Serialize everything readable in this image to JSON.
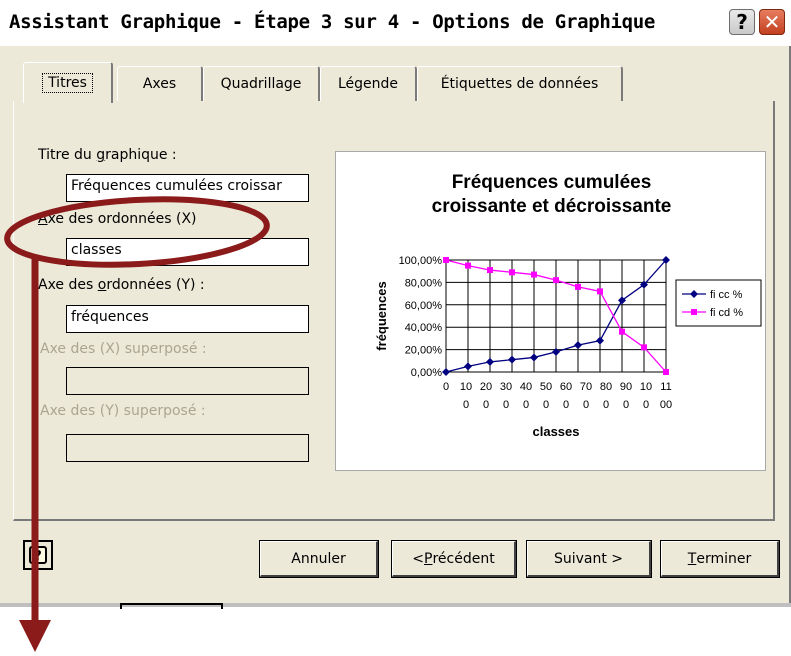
{
  "window": {
    "title": "Assistant Graphique - Étape 3 sur 4 - Options de Graphique",
    "help_glyph": "?",
    "close_glyph": "✕"
  },
  "tabs": [
    {
      "label": "Titres",
      "active": true
    },
    {
      "label": "Axes",
      "active": false
    },
    {
      "label": "Quadrillage",
      "active": false
    },
    {
      "label": "Légende",
      "active": false
    },
    {
      "label": "Étiquettes de données",
      "active": false
    }
  ],
  "form": {
    "chart_title_label_pre": "Titre du ",
    "chart_title_label_key": "g",
    "chart_title_label_post": "raphique :",
    "chart_title_value": "Fréquences cumulées croissar",
    "x_axis_label_key": "A",
    "x_axis_label_post": "xe des ordonnées (X)",
    "x_axis_value": "classes",
    "y_axis_label_pre": "Axe des ",
    "y_axis_label_key": "o",
    "y_axis_label_post": "rdonnées (Y) :",
    "y_axis_value": "fréquences",
    "x2_axis_label": "Axe des (X)  superposé :",
    "x2_axis_value": "",
    "y2_axis_label": "Axe des (Y) superposé :",
    "y2_axis_value": ""
  },
  "buttons": {
    "cancel": "Annuler",
    "prev_pre": "< ",
    "prev_key": "P",
    "prev_post": "récédent",
    "next": "Suivant >",
    "finish_key": "T",
    "finish_post": "erminer",
    "help_icon": "?"
  },
  "colors": {
    "dialog_bg": "#ece9d8",
    "annotation": "#8b1a1a",
    "series1": "#000080",
    "series2": "#ff00ff",
    "plot_bg": "#ffffff"
  },
  "chart_data": {
    "type": "line",
    "title_line1": "Fréquences cumulées",
    "title_line2": "croissante et décroissante",
    "xlabel": "classes",
    "ylabel": "fréquences",
    "x_tick_top": [
      "0",
      "10",
      "20",
      "30",
      "40",
      "50",
      "60",
      "70",
      "80",
      "90",
      "10",
      "11"
    ],
    "x_tick_bottom": [
      "",
      "0",
      "0",
      "0",
      "0",
      "0",
      "0",
      "0",
      "0",
      "0",
      "0",
      "00"
    ],
    "y_ticks": [
      "100,00%",
      "80,00%",
      "60,00%",
      "40,00%",
      "20,00%",
      "0,00%"
    ],
    "ylim": [
      0,
      100
    ],
    "x": [
      0,
      10,
      20,
      30,
      40,
      50,
      60,
      70,
      80,
      90,
      100
    ],
    "series": [
      {
        "name": "fi cc %",
        "values": [
          0,
          5,
          9,
          11,
          13,
          18,
          24,
          28,
          64,
          78,
          100
        ],
        "color": "#000080",
        "marker": "diamond"
      },
      {
        "name": "fi cd %",
        "values": [
          100,
          95,
          91,
          89,
          87,
          82,
          76,
          72,
          36,
          22,
          0
        ],
        "color": "#ff00ff",
        "marker": "square"
      }
    ],
    "grid": true,
    "legend_position": "right"
  }
}
